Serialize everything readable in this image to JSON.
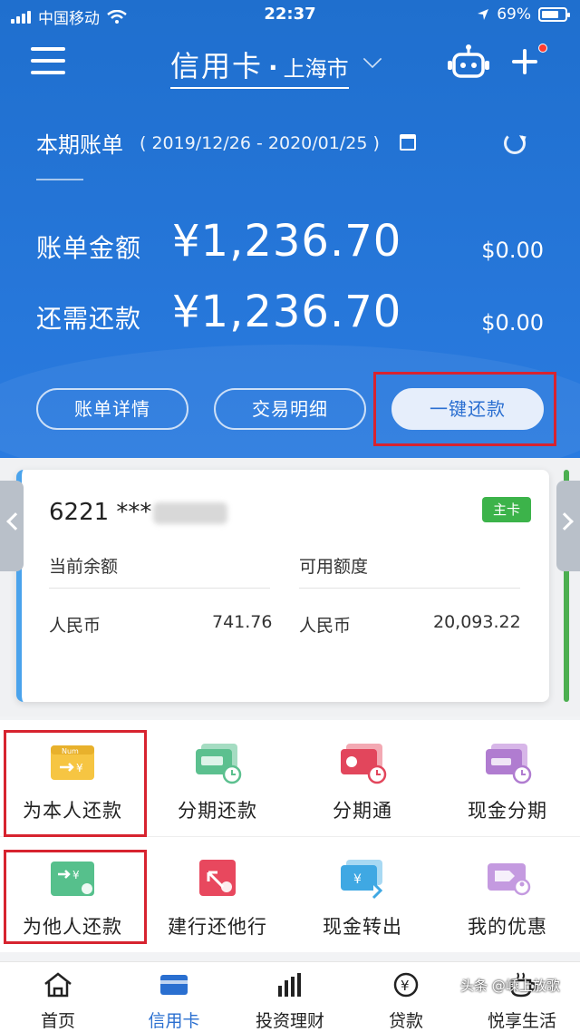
{
  "status_bar": {
    "carrier": "中国移动",
    "time": "22:37",
    "battery": "69%"
  },
  "nav": {
    "title": "信用卡",
    "separator": "·",
    "city": "上海市"
  },
  "bill": {
    "period_label": "本期账单",
    "period_dates": "( 2019/12/26 - 2020/01/25 )",
    "bill_amount_label": "账单金额",
    "bill_amount": "¥1,236.70",
    "bill_amount_usd": "$0.00",
    "due_label": "还需还款",
    "due_amount": "¥1,236.70",
    "due_usd": "$0.00"
  },
  "buttons": {
    "details": "账单详情",
    "transactions": "交易明细",
    "one_click_pay": "一键还款"
  },
  "card": {
    "number": "6221 ***",
    "badge": "主卡",
    "balance_label": "当前余额",
    "credit_label": "可用额度",
    "currency": "人民币",
    "balance": "741.76",
    "credit": "20,093.22"
  },
  "functions": [
    {
      "label": "为本人还款",
      "icon": "self-repay-icon"
    },
    {
      "label": "分期还款",
      "icon": "installment-repay-icon"
    },
    {
      "label": "分期通",
      "icon": "installment-pass-icon"
    },
    {
      "label": "现金分期",
      "icon": "cash-installment-icon"
    },
    {
      "label": "为他人还款",
      "icon": "others-repay-icon"
    },
    {
      "label": "建行还他行",
      "icon": "ccb-repay-other-bank-icon"
    },
    {
      "label": "现金转出",
      "icon": "cash-transfer-icon"
    },
    {
      "label": "我的优惠",
      "icon": "my-offers-icon"
    }
  ],
  "tabs": [
    {
      "label": "首页",
      "icon": "home-icon"
    },
    {
      "label": "信用卡",
      "icon": "credit-card-icon"
    },
    {
      "label": "投资理财",
      "icon": "investment-icon"
    },
    {
      "label": "贷款",
      "icon": "loan-icon"
    },
    {
      "label": "悦享生活",
      "icon": "lifestyle-icon"
    }
  ],
  "watermark": "头条 @嵊上放歌",
  "colors": {
    "header_blue": "#2a7be0",
    "highlight_red": "#d7232f",
    "badge_green": "#3cb34a",
    "active_tab": "#2a6fd0"
  }
}
